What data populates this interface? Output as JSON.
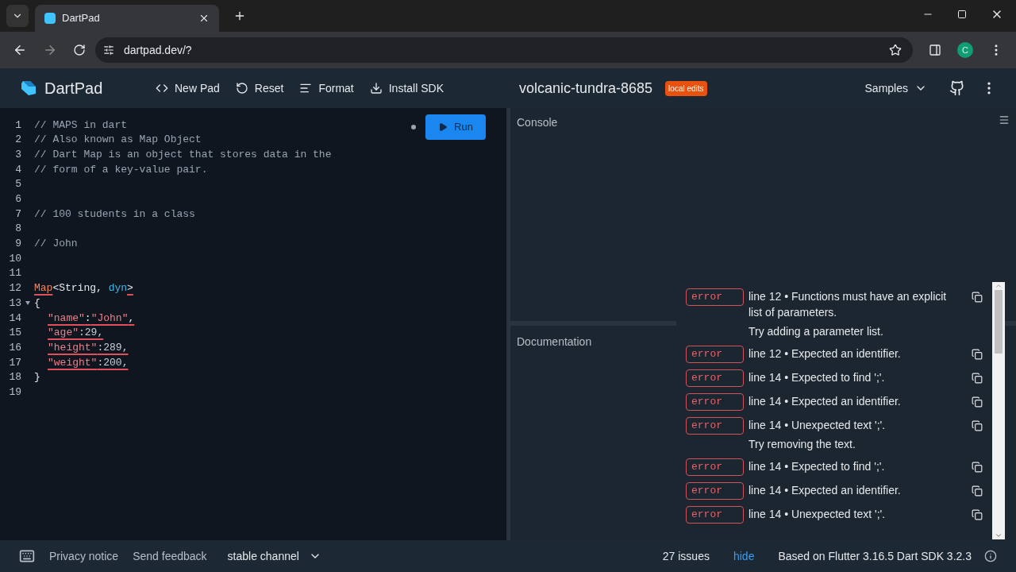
{
  "browser": {
    "tab_title": "DartPad",
    "url": "dartpad.dev/?",
    "profile_initial": "C"
  },
  "header": {
    "app_name": "DartPad",
    "actions": [
      {
        "label": "New Pad",
        "kind": "code"
      },
      {
        "label": "Reset",
        "kind": "reset"
      },
      {
        "label": "Format",
        "kind": "format"
      },
      {
        "label": "Install SDK",
        "kind": "download"
      }
    ],
    "pad_name": "volcanic-tundra-8685",
    "badge": "local edits",
    "samples": "Samples"
  },
  "editor": {
    "run_label": "Run",
    "lines": [
      {
        "number": "1",
        "tokens": [
          {
            "text": "// MAPS in dart",
            "kind": "comment",
            "underlined": false
          }
        ]
      },
      {
        "number": "2",
        "tokens": [
          {
            "text": "// Also known as Map Object",
            "kind": "comment",
            "underlined": false
          }
        ]
      },
      {
        "number": "3",
        "tokens": [
          {
            "text": "// Dart Map is an object that stores data in the",
            "kind": "comment",
            "underlined": false
          }
        ]
      },
      {
        "number": "4",
        "tokens": [
          {
            "text": "// form of a key-value pair.",
            "kind": "comment",
            "underlined": false
          }
        ]
      },
      {
        "number": "5"
      },
      {
        "number": "6"
      },
      {
        "number": "7",
        "tokens": [
          {
            "text": "// 100 students in a class",
            "kind": "comment",
            "underlined": false
          }
        ]
      },
      {
        "number": "8"
      },
      {
        "number": "9",
        "tokens": [
          {
            "text": "// John",
            "kind": "comment",
            "underlined": false
          }
        ]
      },
      {
        "number": "10"
      },
      {
        "number": "11"
      },
      {
        "number": "12",
        "tokens": [
          {
            "text": "Map",
            "kind": "type",
            "underlined": true
          },
          {
            "text": "<String, ",
            "kind": "plain",
            "underlined": false
          },
          {
            "text": "dyn",
            "kind": "keyword",
            "underlined": false
          },
          {
            "text": ">",
            "kind": "plain",
            "underlined": true
          }
        ]
      },
      {
        "number": "13",
        "foldable": true,
        "tokens": [
          {
            "text": "{",
            "kind": "plain",
            "underlined": false
          }
        ]
      },
      {
        "number": "14",
        "indented": true,
        "tokens": [
          {
            "text": "\"name\"",
            "kind": "string",
            "underlined": true
          },
          {
            "text": ":",
            "kind": "plain",
            "underlined": true
          },
          {
            "text": "\"John\"",
            "kind": "string",
            "underlined": true
          },
          {
            "text": ",",
            "kind": "plain",
            "underlined": true
          }
        ]
      },
      {
        "number": "15",
        "indented": true,
        "tokens": [
          {
            "text": "\"age\"",
            "kind": "string",
            "underlined": true
          },
          {
            "text": ":29,",
            "kind": "number",
            "underlined": true
          }
        ]
      },
      {
        "number": "16",
        "indented": true,
        "tokens": [
          {
            "text": "\"height\"",
            "kind": "string",
            "underlined": true
          },
          {
            "text": ":289,",
            "kind": "number",
            "underlined": true
          }
        ]
      },
      {
        "number": "17",
        "indented": true,
        "tokens": [
          {
            "text": "\"weight\"",
            "kind": "string",
            "underlined": true
          },
          {
            "text": ":200,",
            "kind": "number",
            "underlined": true
          }
        ]
      },
      {
        "number": "18",
        "tokens": [
          {
            "text": "}",
            "kind": "plain",
            "underlined": false
          }
        ]
      },
      {
        "number": "19"
      }
    ]
  },
  "console": {
    "title": "Console"
  },
  "documentation": {
    "title": "Documentation"
  },
  "issues": [
    {
      "severity": "error",
      "message": "line 12 • Functions must have an explicit list of parameters.",
      "hint": "Try adding a parameter list."
    },
    {
      "severity": "error",
      "message": "line 12 • Expected an identifier."
    },
    {
      "severity": "error",
      "message": "line 14 • Expected to find ';'."
    },
    {
      "severity": "error",
      "message": "line 14 • Expected an identifier."
    },
    {
      "severity": "error",
      "message": "line 14 • Unexpected text ';'.",
      "hint": "Try removing the text."
    },
    {
      "severity": "error",
      "message": "line 14 • Expected to find ';'."
    },
    {
      "severity": "error",
      "message": "line 14 • Expected an identifier."
    },
    {
      "severity": "error",
      "message": "line 14 • Unexpected text ';'."
    }
  ],
  "footer": {
    "links": [
      "Privacy notice",
      "Send feedback"
    ],
    "channel": "stable channel",
    "issue_count": "27 issues",
    "hide": "hide",
    "version": "Based on Flutter 3.16.5 Dart SDK 3.2.3"
  }
}
